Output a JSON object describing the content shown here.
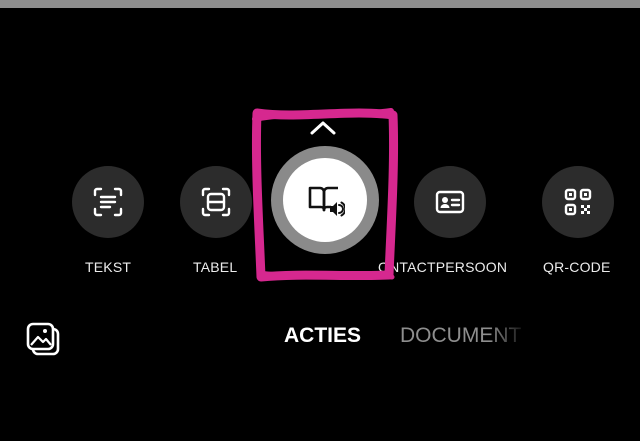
{
  "modes": {
    "tekst": {
      "label": "TEKST",
      "icon": "text-scan-icon"
    },
    "tabel": {
      "label": "TABEL",
      "icon": "table-scan-icon"
    },
    "voorlezen": {
      "icon": "book-speaker-icon",
      "selected": true
    },
    "contactpersoon": {
      "label": "ONTACTPERSOON",
      "icon": "contact-card-icon"
    },
    "qr": {
      "label": "QR-CODE",
      "icon": "qr-code-icon"
    }
  },
  "tabs": {
    "acties": "ACTIES",
    "document": "DOCUMENT",
    "active": "acties"
  },
  "colors": {
    "background": "#000000",
    "button": "#2c2c2c",
    "highlight": "#d6288f",
    "inactive_tab": "#8e8e8e"
  }
}
